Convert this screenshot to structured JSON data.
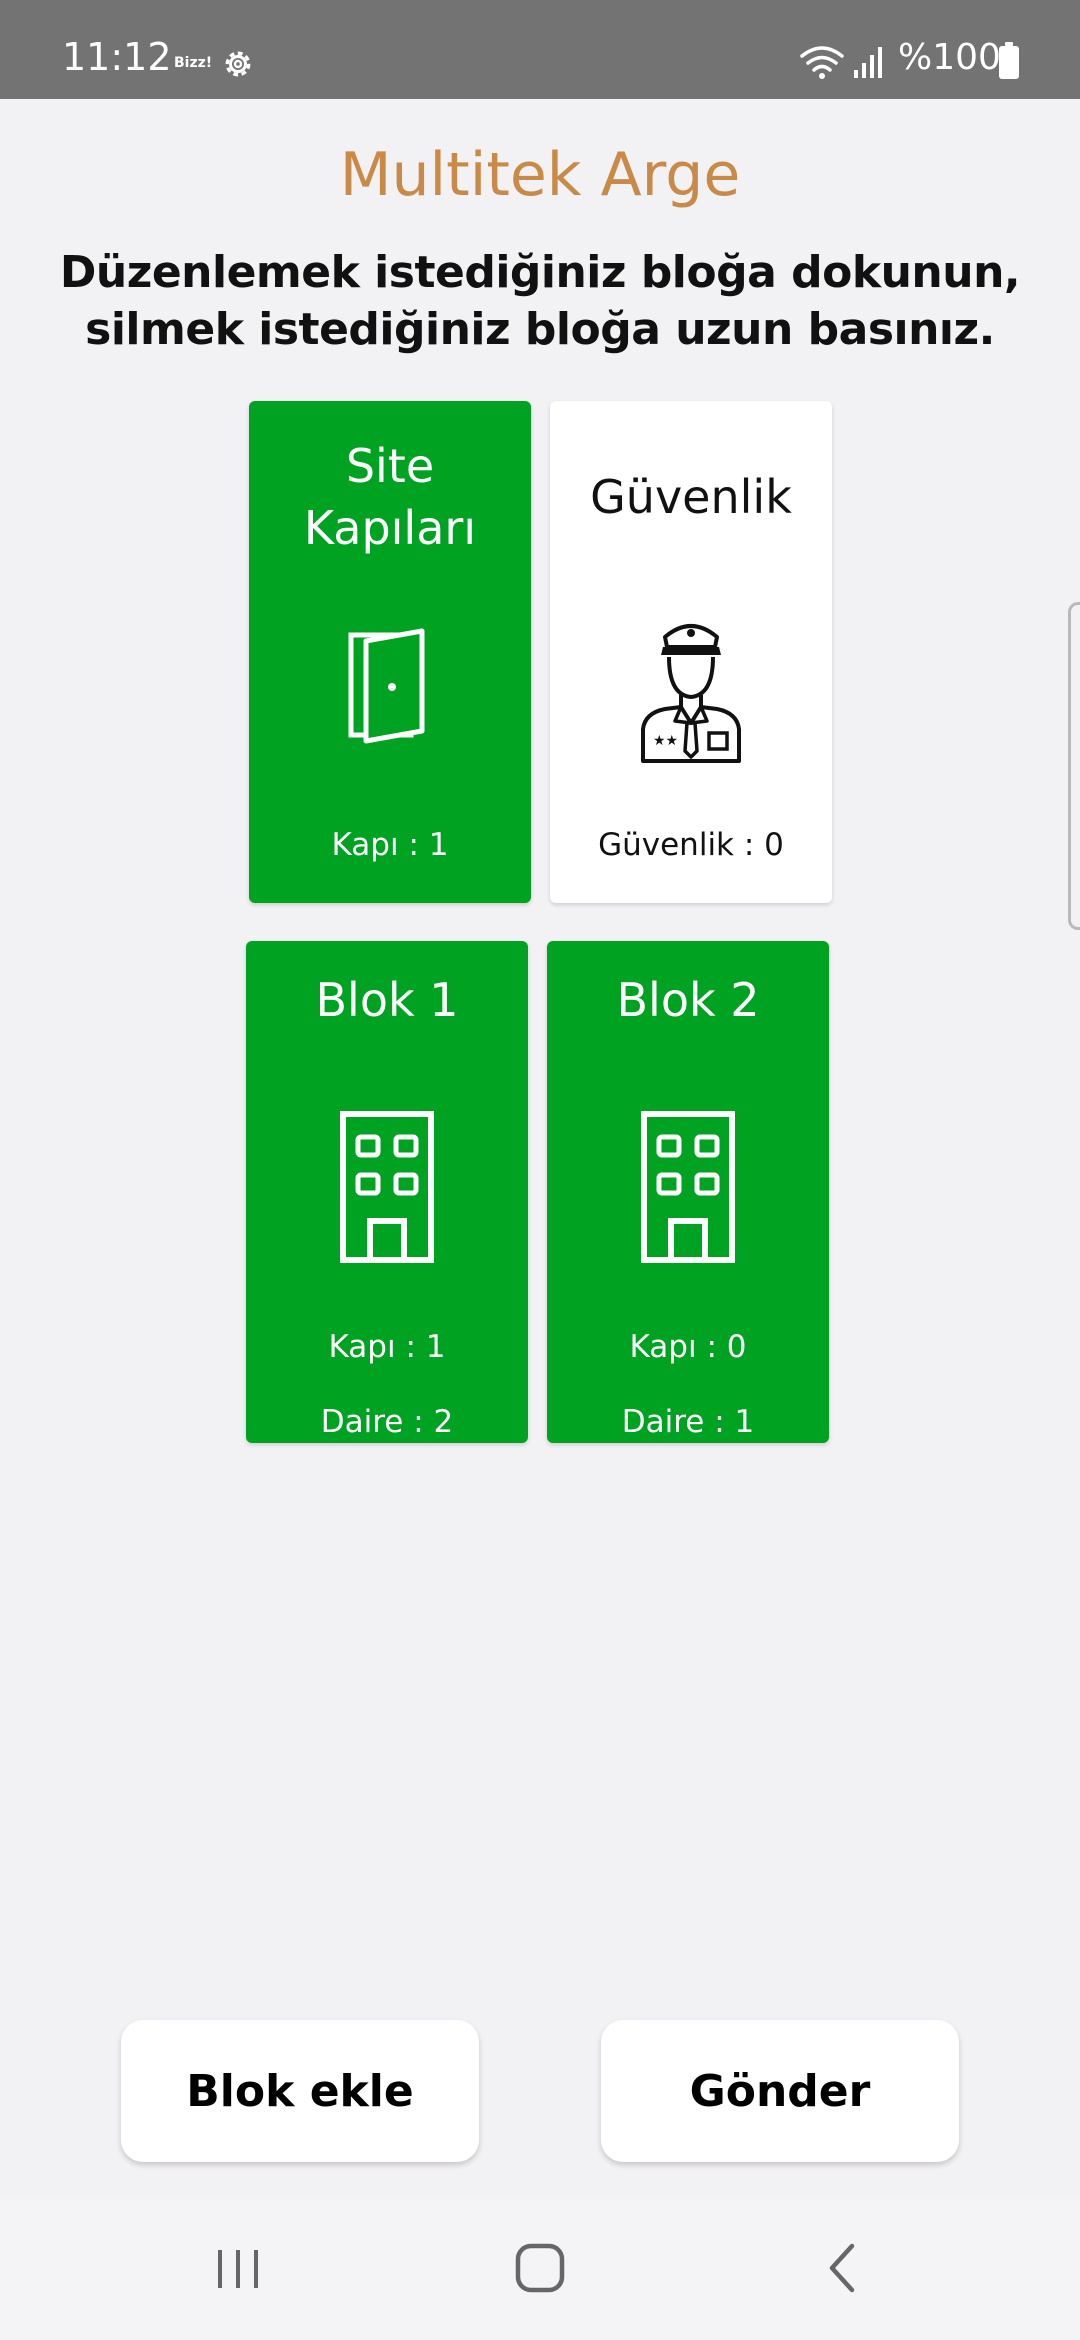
{
  "status_bar": {
    "time": "11:12",
    "tag": "Bizz!",
    "battery_text": "%100",
    "icons": [
      "gear-icon",
      "wifi-icon",
      "signal-icon",
      "battery-icon"
    ]
  },
  "header": {
    "title": "Multitek Arge",
    "instruction": "Düzenlemek istediğiniz bloğa dokunun, silmek istediğiniz bloğa uzun basınız."
  },
  "cards": {
    "site": {
      "title_line1": "Site",
      "title_line2": "Kapıları",
      "stat1": "Kapı : 1",
      "icon": "door-icon"
    },
    "guvenlik": {
      "title": "Güvenlik",
      "stat1": "Güvenlik : 0",
      "icon": "security-guard-icon"
    },
    "blok1": {
      "title": "Blok 1",
      "stat1": "Kapı : 1",
      "stat2": "Daire : 2",
      "icon": "building-icon"
    },
    "blok2": {
      "title": "Blok 2",
      "stat1": "Kapı : 0",
      "stat2": "Daire : 1",
      "icon": "building-icon"
    }
  },
  "actions": {
    "add_block_label": "Blok ekle",
    "send_label": "Gönder"
  },
  "colors": {
    "status_bar": "#737373",
    "background": "#f2f1f4",
    "title": "#c98a48",
    "card_green": "#00a321",
    "card_white": "#ffffff"
  },
  "nav": {
    "icons": [
      "recents-icon",
      "home-icon",
      "back-icon"
    ]
  }
}
